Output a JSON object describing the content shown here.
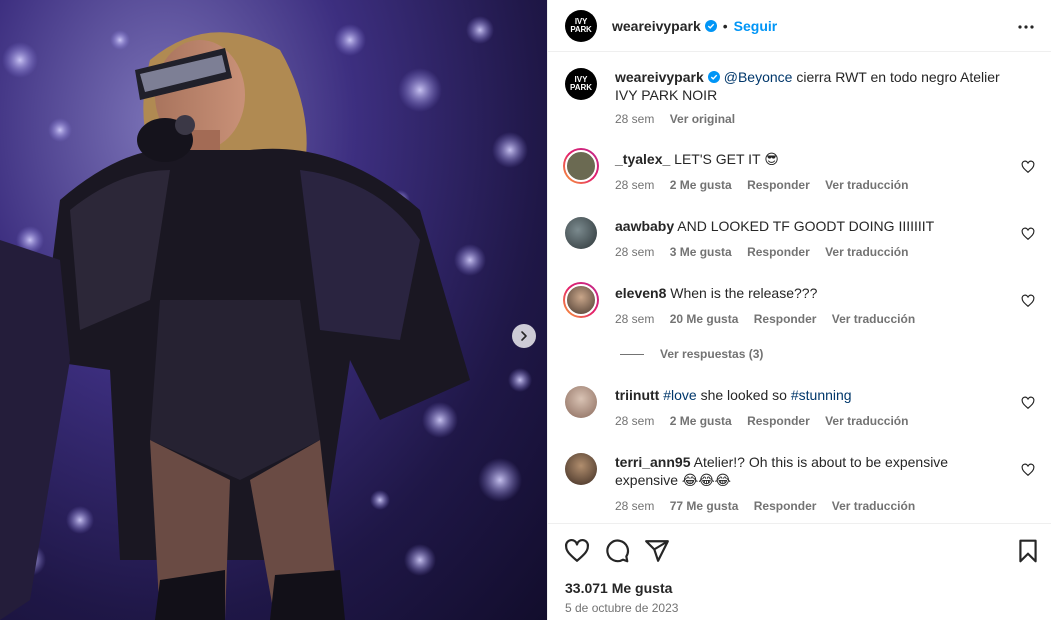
{
  "header": {
    "username": "weareivypark",
    "follow_label": "Seguir",
    "dot": "•",
    "logo_line1": "IVY",
    "logo_line2": "PARK"
  },
  "caption": {
    "username": "weareivypark",
    "mention": "@Beyonce",
    "text": " cierra RWT en todo negro Atelier IVY PARK NOIR",
    "age": "28 sem",
    "see_original": "Ver original"
  },
  "comments": [
    {
      "username": "_tyalex_",
      "text": "LET'S GET IT 😎",
      "age": "28 sem",
      "likes": "2 Me gusta",
      "reply": "Responder",
      "translate": "Ver traducción"
    },
    {
      "username": "aawbaby",
      "text": "AND LOOKED TF GOODT DOING IIIIIIIT",
      "age": "28 sem",
      "likes": "3 Me gusta",
      "reply": "Responder",
      "translate": "Ver traducción"
    },
    {
      "username": "eleven8",
      "text": "When is the release???",
      "age": "28 sem",
      "likes": "20 Me gusta",
      "reply": "Responder",
      "translate": "Ver traducción"
    },
    {
      "username": "triinutt",
      "hashtag1": "#love",
      "text_mid": " she looked so ",
      "hashtag2": "#stunning",
      "age": "28 sem",
      "likes": "2 Me gusta",
      "reply": "Responder",
      "translate": "Ver traducción"
    },
    {
      "username": "terri_ann95",
      "text": "Atelier!? Oh this is about to be expensive expensive 😂😂😂",
      "age": "28 sem",
      "likes": "77 Me gusta",
      "reply": "Responder",
      "translate": "Ver traducción"
    }
  ],
  "view_replies": "Ver respuestas (3)",
  "footer": {
    "likes": "33.071 Me gusta",
    "date": "5 de octubre de 2023"
  },
  "colors": {
    "accent": "#0095f6",
    "link": "#00376b",
    "muted": "#737373"
  }
}
